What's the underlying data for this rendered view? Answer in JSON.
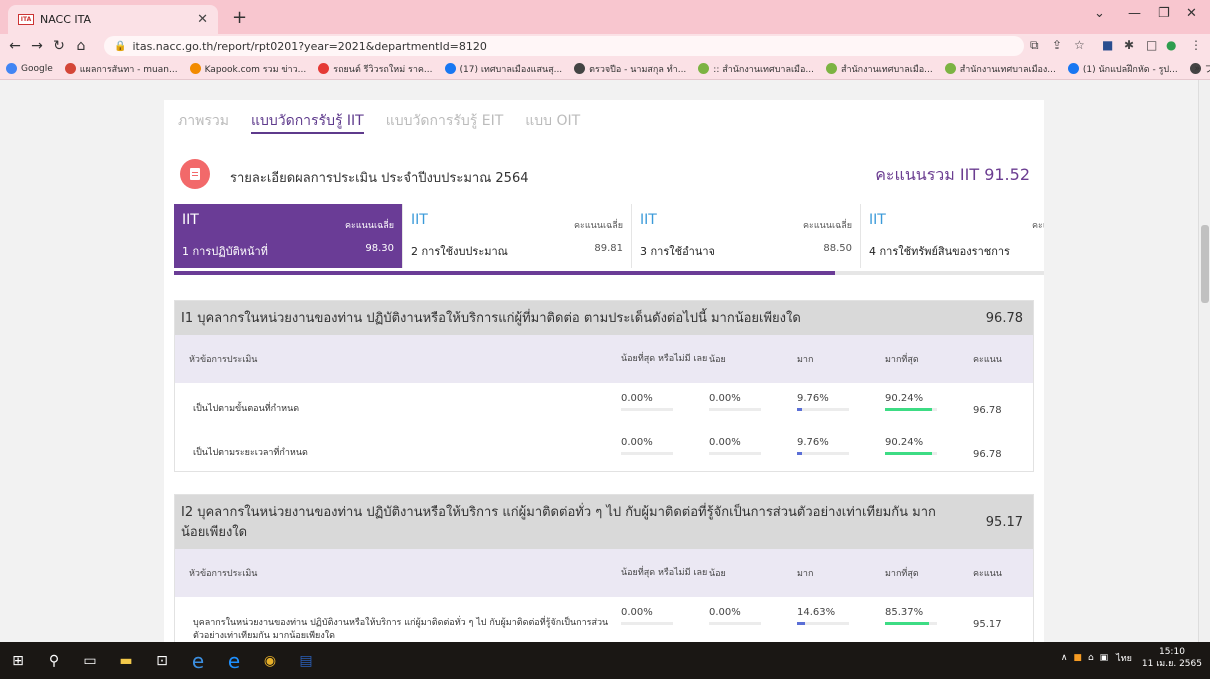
{
  "browser": {
    "tab_title": "NACC ITA",
    "favicon_text": "ITA",
    "url": "itas.nacc.go.th/report/rpt0201?year=2021&departmentId=8120",
    "bookmarks": [
      {
        "label": "Google",
        "color": "#4285f4"
      },
      {
        "label": "แผลการสันทา - muan...",
        "color": "#d44638"
      },
      {
        "label": "Kapook.com รวม ข่าว...",
        "color": "#f28b00"
      },
      {
        "label": "รถยนต์ รีวิวรถใหม่ ราค...",
        "color": "#e53935"
      },
      {
        "label": "(17) เทศบาลเมืองแสนสุ...",
        "color": "#1877f2"
      },
      {
        "label": "ตรวจปีอ - นามสกุล ทำ...",
        "color": "#444444"
      },
      {
        "label": ":: สำนักงานเทศบาลเมือ...",
        "color": "#7cb342"
      },
      {
        "label": "สำนักงานเทศบาลเมือ...",
        "color": "#7cb342"
      },
      {
        "label": "สำนักงานเทศบาลเมือง...",
        "color": "#7cb342"
      },
      {
        "label": "(1) นักแปลฝึกหัด - รูป...",
        "color": "#1877f2"
      },
      {
        "label": "ブロードウェイミュージカ...",
        "color": "#444444"
      }
    ]
  },
  "nav_tabs": [
    {
      "label": "ภาพรวม",
      "active": false
    },
    {
      "label": "แบบวัดการรับรู้ IIT",
      "active": true
    },
    {
      "label": "แบบวัดการรับรู้ EIT",
      "active": false
    },
    {
      "label": "แบบ OIT",
      "active": false
    }
  ],
  "summary": {
    "title": "รายละเอียดผลการประเมิน ประจำปีงบประมาณ 2564",
    "total_label": "คะแนนรวม IIT 91.52"
  },
  "indicators": [
    {
      "code": "IIT",
      "avg_label": "คะแนนเฉลี่ย",
      "name": "1 การปฏิบัติหน้าที่",
      "score": "98.30",
      "active": true
    },
    {
      "code": "IIT",
      "avg_label": "คะแนนเฉลี่ย",
      "name": "2 การใช้งบประมาณ",
      "score": "89.81",
      "active": false
    },
    {
      "code": "IIT",
      "avg_label": "คะแนนเฉลี่ย",
      "name": "3 การใช้อำนาจ",
      "score": "88.50",
      "active": false
    },
    {
      "code": "IIT",
      "avg_label": "คะแนนเฉลี่ย",
      "name": "4 การใช้ทรัพย์สินของราชการ",
      "score": "",
      "active": false
    }
  ],
  "indicator_progress": 0.76,
  "table_headers": {
    "item": "หัวข้อการประเมิน",
    "least": "น้อยที่สุด หรือไม่มี เลย",
    "little": "น้อย",
    "much": "มาก",
    "most": "มากที่สุด",
    "score": "คะแนน"
  },
  "questions": [
    {
      "title": "I1 บุคลากรในหน่วยงานของท่าน ปฏิบัติงานหรือให้บริการแก่ผู้ที่มาติดต่อ ตามประเด็นดังต่อไปนี้ มากน้อยเพียงใด",
      "score": "96.78",
      "rows": [
        {
          "item": "เป็นไปตามขั้นตอนที่กำหนด",
          "least": "0.00%",
          "little": "0.00%",
          "much": "9.76%",
          "most": "90.24%",
          "score": "96.78"
        },
        {
          "item": "เป็นไปตามระยะเวลาที่กำหนด",
          "least": "0.00%",
          "little": "0.00%",
          "much": "9.76%",
          "most": "90.24%",
          "score": "96.78"
        }
      ]
    },
    {
      "title": "I2 บุคลากรในหน่วยงานของท่าน ปฏิบัติงานหรือให้บริการ แก่ผู้มาติดต่อทั่ว ๆ ไป กับผู้มาติดต่อที่รู้จักเป็นการส่วนตัวอย่างเท่าเทียมกัน มาก น้อยเพียงใด",
      "score": "95.17",
      "rows": [
        {
          "item": "บุคลากรในหน่วยงานของท่าน ปฏิบัติงานหรือให้บริการ แก่ผู้มาติดต่อทั่ว ๆ ไป กับผู้มาติดต่อที่รู้จักเป็นการส่วนตัวอย่างเท่าเทียมกัน มากน้อยเพียงใด",
          "least": "0.00%",
          "little": "0.00%",
          "much": "14.63%",
          "most": "85.37%",
          "score": "95.17"
        }
      ]
    }
  ],
  "colors": {
    "accent": "#6a3c96",
    "bar_much": "#5b6fd6",
    "bar_most": "#3ddc84"
  },
  "taskbar": {
    "time": "15:10",
    "date": "11 เม.ย. 2565",
    "lang": "ไทย"
  }
}
